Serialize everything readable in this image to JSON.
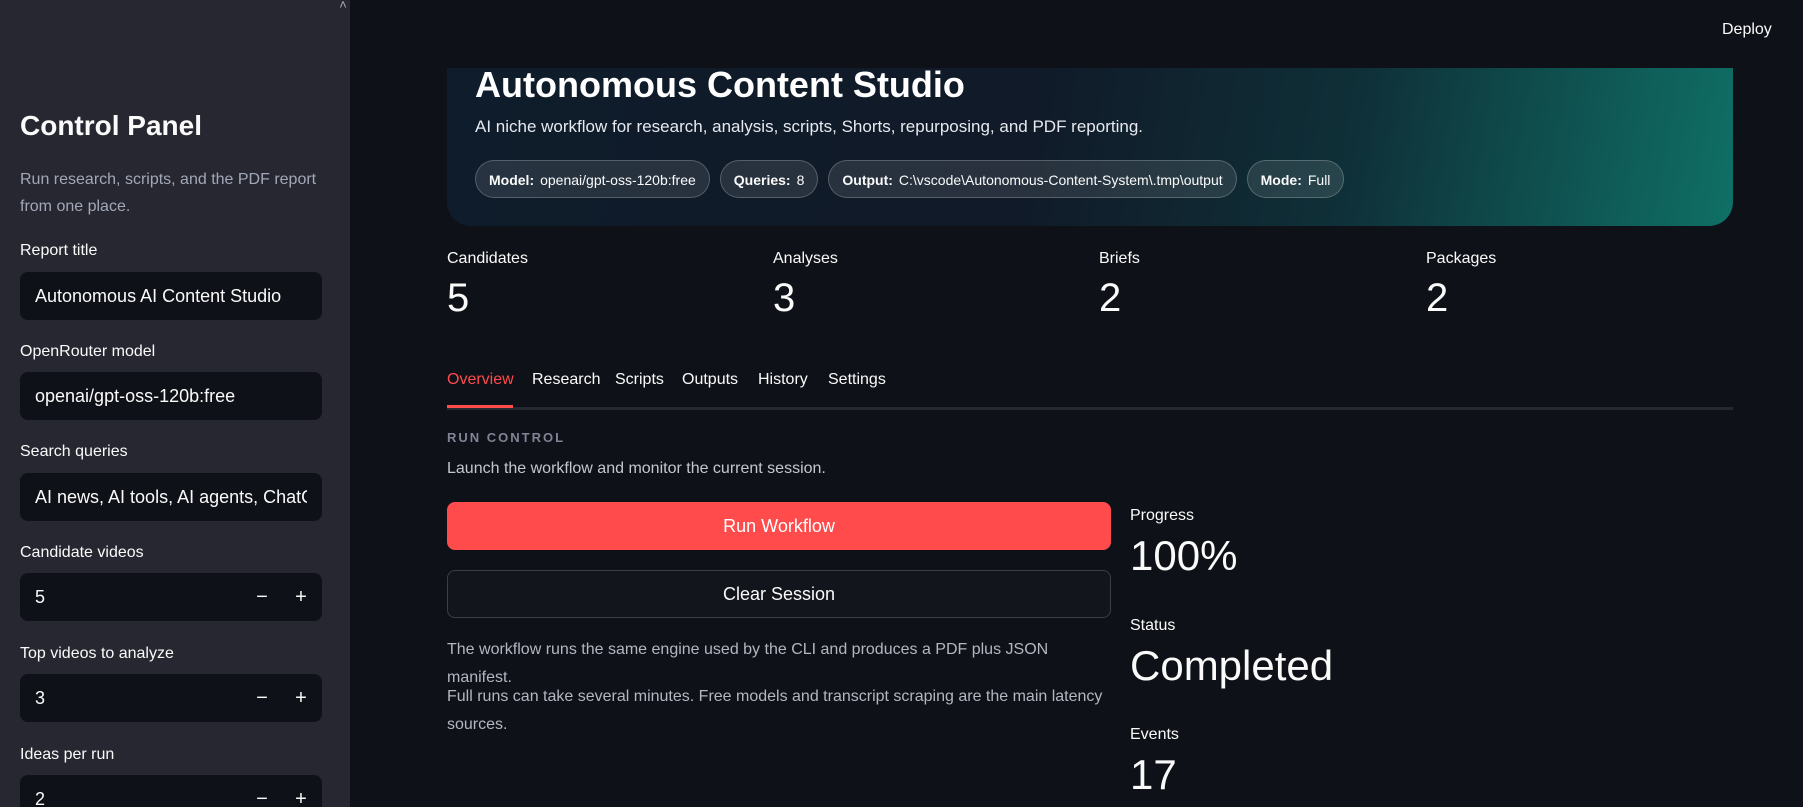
{
  "sidebar": {
    "collapse_glyph": "˄",
    "title": "Control Panel",
    "description": "Run research, scripts, and the PDF report from one place.",
    "fields": {
      "report_title": {
        "label": "Report title",
        "value": "Autonomous AI Content Studio"
      },
      "model": {
        "label": "OpenRouter model",
        "value": "openai/gpt-oss-120b:free"
      },
      "queries": {
        "label": "Search queries",
        "value": "AI news, AI tools, AI agents, ChatGPT"
      },
      "candidates": {
        "label": "Candidate videos",
        "value": "5"
      },
      "top_videos": {
        "label": "Top videos to analyze",
        "value": "3"
      },
      "ideas": {
        "label": "Ideas per run",
        "value": "2"
      }
    },
    "stepper": {
      "minus": "−",
      "plus": "+"
    }
  },
  "header": {
    "deploy_label": "Deploy"
  },
  "hero": {
    "title": "Autonomous Content Studio",
    "subtitle": "AI niche workflow for research, analysis, scripts, Shorts, repurposing, and PDF reporting.",
    "chips": [
      {
        "key": "Model:",
        "value": "openai/gpt-oss-120b:free"
      },
      {
        "key": "Queries:",
        "value": "8"
      },
      {
        "key": "Output:",
        "value": "C:\\vscode\\Autonomous-Content-System\\.tmp\\output"
      },
      {
        "key": "Mode:",
        "value": "Full"
      }
    ]
  },
  "metrics": [
    {
      "label": "Candidates",
      "value": "5"
    },
    {
      "label": "Analyses",
      "value": "3"
    },
    {
      "label": "Briefs",
      "value": "2"
    },
    {
      "label": "Packages",
      "value": "2"
    }
  ],
  "tabs": [
    {
      "label": "Overview",
      "active": true
    },
    {
      "label": "Research"
    },
    {
      "label": "Scripts"
    },
    {
      "label": "Outputs"
    },
    {
      "label": "History"
    },
    {
      "label": "Settings"
    }
  ],
  "run_control": {
    "eyebrow": "RUN CONTROL",
    "description": "Launch the workflow and monitor the current session.",
    "run_button": "Run Workflow",
    "clear_button": "Clear Session",
    "notes": [
      "The workflow runs the same engine used by the CLI and produces a PDF plus JSON manifest.",
      "Full runs can take several minutes. Free models and transcript scraping are the main latency sources."
    ]
  },
  "stats": {
    "progress": {
      "label": "Progress",
      "value": "100%"
    },
    "status": {
      "label": "Status",
      "value": "Completed"
    },
    "events": {
      "label": "Events",
      "value": "17"
    }
  },
  "colors": {
    "accent": "#ff4b4b",
    "background": "#0e1117",
    "sidebar": "#262730"
  }
}
